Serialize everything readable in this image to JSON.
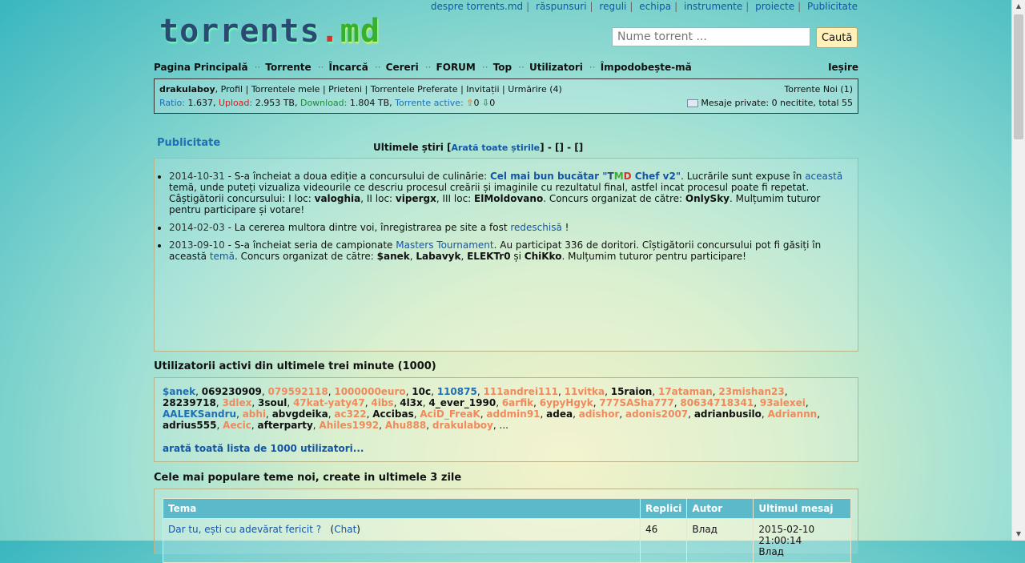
{
  "top_links": [
    "despre torrents.md",
    "răspunsuri",
    "reguli",
    "echipa",
    "instrumente",
    "proiecte",
    "Publicitate"
  ],
  "logo": {
    "main": "torrents",
    "dot": ".",
    "tld": "md"
  },
  "search": {
    "placeholder": "Nume torrent ...",
    "button": "Caută"
  },
  "nav": {
    "items": [
      "Pagina Principală",
      "Torrente",
      "Încarcă",
      "Cereri",
      "FORUM",
      "Top",
      "Utilizatori",
      "Împodobește-mă"
    ],
    "exit": "Ieșire"
  },
  "userbar": {
    "username": "drakulaboy",
    "links": [
      "Profil",
      "Torrentele mele",
      "Prieteni",
      "Torrentele Preferate",
      "Invitații",
      "Urmărire (4)"
    ],
    "ratio_label": "Ratio:",
    "ratio": "1.637",
    "upload_label": "Upload:",
    "upload": "2.953 TB",
    "download_label": "Download:",
    "download": "1.804 TB",
    "active_label": "Torrente active:",
    "active_up": "0",
    "active_down": "0",
    "new_torrents": "Torrente Noi (1)",
    "messages": "Mesaje private: 0 necitite, total 55"
  },
  "publicitate": "Publicitate",
  "news": {
    "title": "Ultimele știri",
    "show_all": "Arată toate știrile",
    "brackets": "] - [] - []",
    "items": [
      {
        "date": "2014-10-31",
        "t1": " - S-a încheiat a doua ediție a concursului de culinărie: ",
        "link1": "Cel mai bun bucătar \"",
        "link1_end": " Chef v2\"",
        "t2": ". Lucrările sunt expuse în ",
        "link2": "această",
        "t3": " temă, unde puteți vizualiza videourile ce descriu procesul creării și imaginile cu rezultatul final, astfel incat procesul poate fi repetat. Câștigătorii concursului: I loc: ",
        "w1": "valoghia",
        "t4": ", II loc: ",
        "w2": "vipergx",
        "t5": ", III loc: ",
        "w3": "ElMoldovano",
        "t6": ". Concurs organizat de către: ",
        "org": "OnlySky",
        "t7": ". Mulțumim tuturor pentru participare și votare!"
      },
      {
        "date": "2014-02-03",
        "t1": " - La cererea multora dintre voi, înregistrarea pe site a fost ",
        "link1": "redeschisă",
        "t2": " !"
      },
      {
        "date": "2013-09-10",
        "t1": " - S-a încheiat seria de campionate ",
        "link1": "Masters Tournament",
        "t2": ". Au participat 336 de doritori. Cîștigătorii concursului pot fi găsiți în această ",
        "link2": "temă",
        "t3": ". Concurs organizat de către: ",
        "o1": "$anek",
        "o2": "Labavyk",
        "o3": "ELEKTr0",
        "t4": " și ",
        "o4": "ChiKko",
        "t5": ". Mulțumim tuturor pentru participare!"
      }
    ]
  },
  "active_users": {
    "title": "Utilizatorii activi din ultimele trei minute (1000)",
    "users": [
      {
        "n": "$anek",
        "c": "blue"
      },
      {
        "n": "069230909",
        "c": "black"
      },
      {
        "n": "079592118",
        "c": "orange"
      },
      {
        "n": "1000000euro",
        "c": "orange"
      },
      {
        "n": "10c",
        "c": "black"
      },
      {
        "n": "110875",
        "c": "blue"
      },
      {
        "n": "111andrei111",
        "c": "orange"
      },
      {
        "n": "11vitka",
        "c": "orange"
      },
      {
        "n": "15raion",
        "c": "black"
      },
      {
        "n": "17ataman",
        "c": "orange"
      },
      {
        "n": "23mishan23",
        "c": "orange"
      },
      {
        "n": "28239718",
        "c": "black"
      },
      {
        "n": "3dlex",
        "c": "orange"
      },
      {
        "n": "3soul",
        "c": "black"
      },
      {
        "n": "47kat-yaty47",
        "c": "orange"
      },
      {
        "n": "4ibs",
        "c": "orange"
      },
      {
        "n": "4l3x",
        "c": "black"
      },
      {
        "n": "4_ever_1990",
        "c": "black"
      },
      {
        "n": "6arfik",
        "c": "orange"
      },
      {
        "n": "6ypyHgyk",
        "c": "orange"
      },
      {
        "n": "777SASha777",
        "c": "orange"
      },
      {
        "n": "80634718341",
        "c": "orange"
      },
      {
        "n": "93alexei",
        "c": "orange"
      },
      {
        "n": "AALEKSandru",
        "c": "blue"
      },
      {
        "n": "abhi",
        "c": "orange"
      },
      {
        "n": "abvgdeika",
        "c": "black"
      },
      {
        "n": "ac322",
        "c": "orange"
      },
      {
        "n": "Accibas",
        "c": "black"
      },
      {
        "n": "AciD_FreaK",
        "c": "orange"
      },
      {
        "n": "addmin91",
        "c": "orange"
      },
      {
        "n": "adea",
        "c": "black"
      },
      {
        "n": "adishor",
        "c": "orange"
      },
      {
        "n": "adonis2007",
        "c": "orange"
      },
      {
        "n": "adrianbusilo",
        "c": "black"
      },
      {
        "n": "Adriannn",
        "c": "orange"
      },
      {
        "n": "adrius555",
        "c": "black"
      },
      {
        "n": "Aecic",
        "c": "orange"
      },
      {
        "n": "afterparty",
        "c": "black"
      },
      {
        "n": "Ahiles1992",
        "c": "orange"
      },
      {
        "n": "Ahu888",
        "c": "orange"
      },
      {
        "n": "drakulaboy",
        "c": "orange"
      }
    ],
    "ellipsis": "...",
    "show_all": "arată toată lista de 1000 utilizatori..."
  },
  "popular": {
    "title": "Cele mai populare teme noi, create in ultimele 3 zile",
    "headers": [
      "Tema",
      "Replici",
      "Autor",
      "Ultimul mesaj"
    ],
    "rows": [
      {
        "topic": "Dar tu, ești cu adevărat fericit ?",
        "cat": "Chat",
        "replies": "46",
        "author": "Влад",
        "last": "2015-02-10 21:00:14",
        "last_by": "Влад"
      }
    ]
  }
}
